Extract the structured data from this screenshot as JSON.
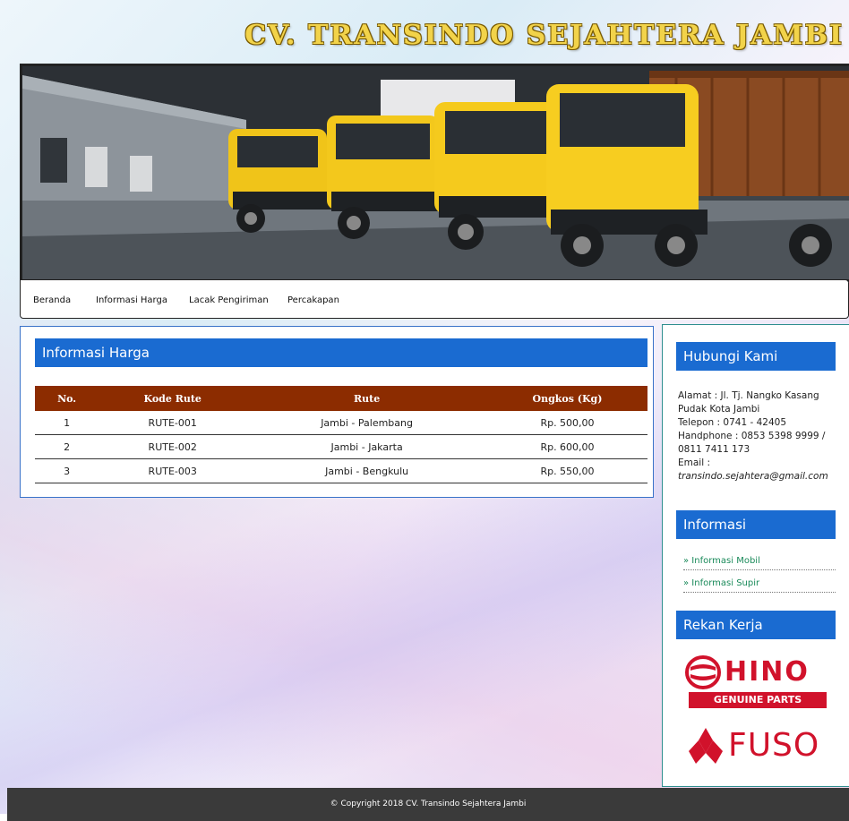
{
  "site": {
    "title": "CV. TRANSINDO SEJAHTERA JAMBI"
  },
  "nav": {
    "items": [
      {
        "label": "Beranda"
      },
      {
        "label": "Informasi Harga"
      },
      {
        "label": "Lacak Pengiriman"
      },
      {
        "label": "Percakapan"
      }
    ]
  },
  "main": {
    "heading": "Informasi Harga",
    "table": {
      "headers": [
        "No.",
        "Kode Rute",
        "Rute",
        "Ongkos (Kg)"
      ],
      "rows": [
        [
          "1",
          "RUTE-001",
          "Jambi - Palembang",
          "Rp. 500,00"
        ],
        [
          "2",
          "RUTE-002",
          "Jambi - Jakarta",
          "Rp. 600,00"
        ],
        [
          "3",
          "RUTE-003",
          "Jambi - Bengkulu",
          "Rp. 550,00"
        ]
      ]
    }
  },
  "sidebar": {
    "contact": {
      "heading": "Hubungi Kami",
      "address_line1": "Alamat : Jl. Tj. Nangko Kasang",
      "address_line2": "Pudak Kota Jambi",
      "phone": "Telepon : 0741 - 42405",
      "handphone_line1": "Handphone : 0853 5398 9999 /",
      "handphone_line2": "0811 7411 173",
      "email_label": "Email :",
      "email_value": "transindo.sejahtera@gmail.com"
    },
    "info": {
      "heading": "Informasi",
      "links": [
        {
          "label": "» Informasi Mobil"
        },
        {
          "label": "» Informasi Supir"
        }
      ]
    },
    "partners": {
      "heading": "Rekan Kerja",
      "hino_text": "HINO",
      "hino_sub": "GENUINE PARTS",
      "fuso_text": "FUSO"
    }
  },
  "footer": {
    "text": "© Copyright 2018 CV. Transindo Sejahtera Jambi"
  },
  "colors": {
    "accent_blue": "#1a6bd1",
    "table_header": "#8c2c00",
    "title_gold": "#f2d34a",
    "hino_red": "#d1122b",
    "fuso_red": "#d1122b",
    "footer_bg": "#3a3a3a"
  }
}
